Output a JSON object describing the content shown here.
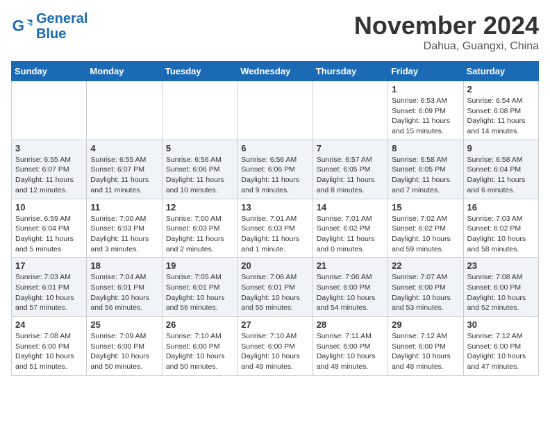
{
  "header": {
    "logo_line1": "General",
    "logo_line2": "Blue",
    "month": "November 2024",
    "location": "Dahua, Guangxi, China"
  },
  "weekdays": [
    "Sunday",
    "Monday",
    "Tuesday",
    "Wednesday",
    "Thursday",
    "Friday",
    "Saturday"
  ],
  "weeks": [
    [
      {
        "day": "",
        "info": ""
      },
      {
        "day": "",
        "info": ""
      },
      {
        "day": "",
        "info": ""
      },
      {
        "day": "",
        "info": ""
      },
      {
        "day": "",
        "info": ""
      },
      {
        "day": "1",
        "info": "Sunrise: 6:53 AM\nSunset: 6:09 PM\nDaylight: 11 hours and 15 minutes."
      },
      {
        "day": "2",
        "info": "Sunrise: 6:54 AM\nSunset: 6:08 PM\nDaylight: 11 hours and 14 minutes."
      }
    ],
    [
      {
        "day": "3",
        "info": "Sunrise: 6:55 AM\nSunset: 6:07 PM\nDaylight: 11 hours and 12 minutes."
      },
      {
        "day": "4",
        "info": "Sunrise: 6:55 AM\nSunset: 6:07 PM\nDaylight: 11 hours and 11 minutes."
      },
      {
        "day": "5",
        "info": "Sunrise: 6:56 AM\nSunset: 6:06 PM\nDaylight: 11 hours and 10 minutes."
      },
      {
        "day": "6",
        "info": "Sunrise: 6:56 AM\nSunset: 6:06 PM\nDaylight: 11 hours and 9 minutes."
      },
      {
        "day": "7",
        "info": "Sunrise: 6:57 AM\nSunset: 6:05 PM\nDaylight: 11 hours and 8 minutes."
      },
      {
        "day": "8",
        "info": "Sunrise: 6:58 AM\nSunset: 6:05 PM\nDaylight: 11 hours and 7 minutes."
      },
      {
        "day": "9",
        "info": "Sunrise: 6:58 AM\nSunset: 6:04 PM\nDaylight: 11 hours and 6 minutes."
      }
    ],
    [
      {
        "day": "10",
        "info": "Sunrise: 6:59 AM\nSunset: 6:04 PM\nDaylight: 11 hours and 5 minutes."
      },
      {
        "day": "11",
        "info": "Sunrise: 7:00 AM\nSunset: 6:03 PM\nDaylight: 11 hours and 3 minutes."
      },
      {
        "day": "12",
        "info": "Sunrise: 7:00 AM\nSunset: 6:03 PM\nDaylight: 11 hours and 2 minutes."
      },
      {
        "day": "13",
        "info": "Sunrise: 7:01 AM\nSunset: 6:03 PM\nDaylight: 11 hours and 1 minute."
      },
      {
        "day": "14",
        "info": "Sunrise: 7:01 AM\nSunset: 6:02 PM\nDaylight: 11 hours and 0 minutes."
      },
      {
        "day": "15",
        "info": "Sunrise: 7:02 AM\nSunset: 6:02 PM\nDaylight: 10 hours and 59 minutes."
      },
      {
        "day": "16",
        "info": "Sunrise: 7:03 AM\nSunset: 6:02 PM\nDaylight: 10 hours and 58 minutes."
      }
    ],
    [
      {
        "day": "17",
        "info": "Sunrise: 7:03 AM\nSunset: 6:01 PM\nDaylight: 10 hours and 57 minutes."
      },
      {
        "day": "18",
        "info": "Sunrise: 7:04 AM\nSunset: 6:01 PM\nDaylight: 10 hours and 56 minutes."
      },
      {
        "day": "19",
        "info": "Sunrise: 7:05 AM\nSunset: 6:01 PM\nDaylight: 10 hours and 56 minutes."
      },
      {
        "day": "20",
        "info": "Sunrise: 7:06 AM\nSunset: 6:01 PM\nDaylight: 10 hours and 55 minutes."
      },
      {
        "day": "21",
        "info": "Sunrise: 7:06 AM\nSunset: 6:00 PM\nDaylight: 10 hours and 54 minutes."
      },
      {
        "day": "22",
        "info": "Sunrise: 7:07 AM\nSunset: 6:00 PM\nDaylight: 10 hours and 53 minutes."
      },
      {
        "day": "23",
        "info": "Sunrise: 7:08 AM\nSunset: 6:00 PM\nDaylight: 10 hours and 52 minutes."
      }
    ],
    [
      {
        "day": "24",
        "info": "Sunrise: 7:08 AM\nSunset: 6:00 PM\nDaylight: 10 hours and 51 minutes."
      },
      {
        "day": "25",
        "info": "Sunrise: 7:09 AM\nSunset: 6:00 PM\nDaylight: 10 hours and 50 minutes."
      },
      {
        "day": "26",
        "info": "Sunrise: 7:10 AM\nSunset: 6:00 PM\nDaylight: 10 hours and 50 minutes."
      },
      {
        "day": "27",
        "info": "Sunrise: 7:10 AM\nSunset: 6:00 PM\nDaylight: 10 hours and 49 minutes."
      },
      {
        "day": "28",
        "info": "Sunrise: 7:11 AM\nSunset: 6:00 PM\nDaylight: 10 hours and 48 minutes."
      },
      {
        "day": "29",
        "info": "Sunrise: 7:12 AM\nSunset: 6:00 PM\nDaylight: 10 hours and 48 minutes."
      },
      {
        "day": "30",
        "info": "Sunrise: 7:12 AM\nSunset: 6:00 PM\nDaylight: 10 hours and 47 minutes."
      }
    ]
  ]
}
